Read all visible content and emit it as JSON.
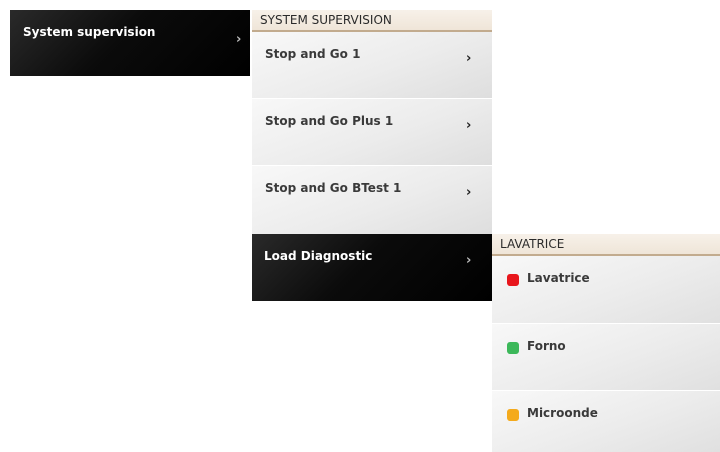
{
  "root_menu": {
    "label": "System supervision",
    "chevron": "›"
  },
  "system_supervision": {
    "header": "SYSTEM SUPERVISION",
    "items": [
      {
        "label": "Stop and Go 1",
        "chevron": "›"
      },
      {
        "label": "Stop and Go Plus 1",
        "chevron": "›"
      },
      {
        "label": "Stop and Go BTest 1",
        "chevron": "›"
      }
    ],
    "active_item": {
      "label": "Load Diagnostic",
      "chevron": "›"
    }
  },
  "lavatrice_panel": {
    "header": "LAVATRICE",
    "loads": [
      {
        "label": "Lavatrice",
        "status_color": "#e8161c"
      },
      {
        "label": "Forno",
        "status_color": "#3cb85a"
      },
      {
        "label": "Microonde",
        "status_color": "#f4aa1c"
      }
    ]
  },
  "colors": {
    "header_background": "#f2eadf",
    "header_border": "#c2ab8e",
    "active_background": "#000000",
    "item_background": "#ececec"
  }
}
